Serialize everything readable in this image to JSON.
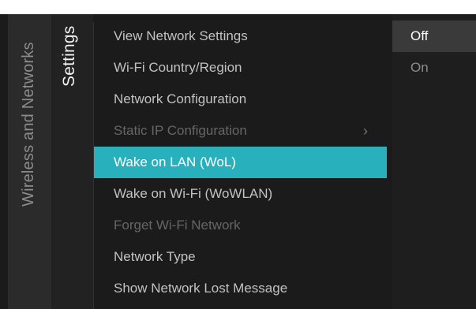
{
  "breadcrumb": {
    "section": "Wireless and Networks",
    "subsection": "Settings"
  },
  "menu": {
    "items": [
      {
        "label": "View Network Settings",
        "state": "normal"
      },
      {
        "label": "Wi-Fi Country/Region",
        "state": "normal"
      },
      {
        "label": "Network Configuration",
        "state": "normal"
      },
      {
        "label": "Static IP Configuration",
        "state": "disabled",
        "submenu_indicator": "›"
      },
      {
        "label": "Wake on LAN (WoL)",
        "state": "selected"
      },
      {
        "label": "Wake on Wi-Fi (WoWLAN)",
        "state": "normal"
      },
      {
        "label": "Forget Wi-Fi Network",
        "state": "disabled"
      },
      {
        "label": "Network Type",
        "state": "normal"
      },
      {
        "label": "Show Network Lost Message",
        "state": "normal"
      }
    ]
  },
  "options": {
    "items": [
      {
        "label": "Off",
        "state": "highlighted"
      },
      {
        "label": "On",
        "state": "normal"
      }
    ]
  },
  "colors": {
    "accent": "#28b0bd",
    "background": "#1b1b1b"
  },
  "icons": {
    "submenu": "chevron-right-icon"
  }
}
